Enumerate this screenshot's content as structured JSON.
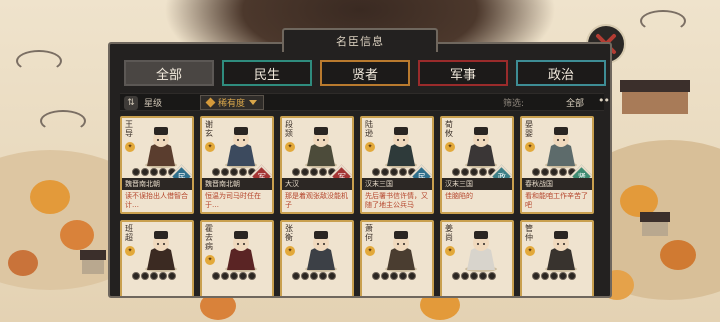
{
  "panel": {
    "title": "名臣信息"
  },
  "tabs": [
    {
      "label": "全部",
      "active": true
    },
    {
      "label": "民生",
      "active": false
    },
    {
      "label": "贤者",
      "active": false
    },
    {
      "label": "军事",
      "active": false
    },
    {
      "label": "政治",
      "active": false
    }
  ],
  "filter": {
    "sort_label": "星级",
    "rarity_label": "稀有度",
    "filter_label": "筛选:",
    "filter_value": "全部",
    "more": "•••"
  },
  "cards": [
    {
      "name": "王导",
      "era": "魏晋南北朝",
      "cls": "民",
      "cls_color": "#2f6f8c",
      "desc": "读不误抬出人借智合计…"
    },
    {
      "name": "谢玄",
      "era": "魏晋南北朝",
      "cls": "军",
      "cls_color": "#a33434",
      "desc": "恒温为司马时任在于…"
    },
    {
      "name": "段颎",
      "era": "大汉",
      "cls": "军",
      "cls_color": "#a33434",
      "desc": "那是着观张敌没能机子"
    },
    {
      "name": "陆逊",
      "era": "汉末三国",
      "cls": "民",
      "cls_color": "#2f6f8c",
      "desc": "先后署书信许情，又随了地主公兵马"
    },
    {
      "name": "荀攸",
      "era": "汉末三国",
      "cls": "政",
      "cls_color": "#3d7f87",
      "desc": "佳脑陷的"
    },
    {
      "name": "晏婴",
      "era": "春秋战国",
      "cls": "贤",
      "cls_color": "#3e8b72",
      "desc": "看和能咱工作辛苦了吧"
    },
    {
      "name": "班超",
      "era": "",
      "cls": "",
      "cls_color": "#a33434",
      "desc": ""
    },
    {
      "name": "霍去病",
      "era": "",
      "cls": "",
      "cls_color": "#a33434",
      "desc": ""
    },
    {
      "name": "张衡",
      "era": "",
      "cls": "",
      "cls_color": "#2f6f8c",
      "desc": ""
    },
    {
      "name": "萧何",
      "era": "",
      "cls": "",
      "cls_color": "#3d7f87",
      "desc": ""
    },
    {
      "name": "姜尚",
      "era": "",
      "cls": "",
      "cls_color": "#3e8b72",
      "desc": ""
    },
    {
      "name": "管仲",
      "era": "",
      "cls": "",
      "cls_color": "#3d7f87",
      "desc": ""
    }
  ]
}
